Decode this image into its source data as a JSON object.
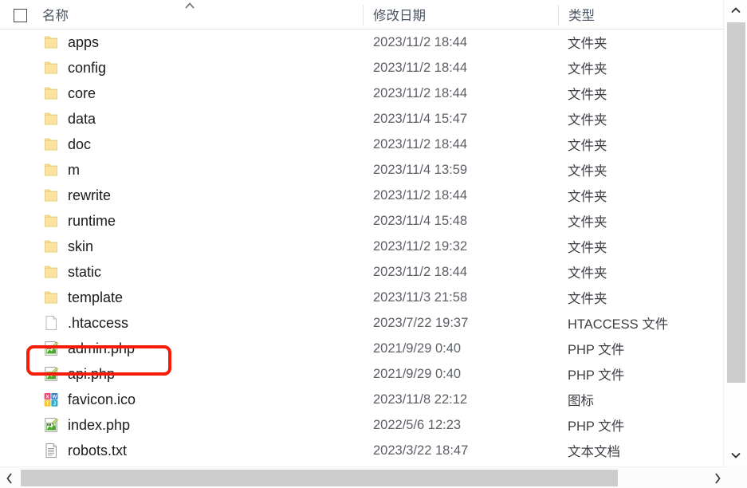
{
  "window": {
    "app": "file-explorer",
    "accent_annotation_color": "#f81b06",
    "folder_icon_color": "#fbdf9b",
    "php_icon_color": "#4aaf2a"
  },
  "columns": {
    "name": "名称",
    "date_modified": "修改日期",
    "type": "类型",
    "sort_indicator": "chevron-up-icon"
  },
  "types": {
    "folder": "文件夹",
    "htaccess": "HTACCESS 文件",
    "php": "PHP 文件",
    "icon": "图标",
    "text": "文本文档"
  },
  "rows": [
    {
      "name": "apps",
      "date": "2023/11/2 18:44",
      "type": "文件夹",
      "icon": "folder-icon"
    },
    {
      "name": "config",
      "date": "2023/11/2 18:44",
      "type": "文件夹",
      "icon": "folder-icon"
    },
    {
      "name": "core",
      "date": "2023/11/2 18:44",
      "type": "文件夹",
      "icon": "folder-icon"
    },
    {
      "name": "data",
      "date": "2023/11/4 15:47",
      "type": "文件夹",
      "icon": "folder-icon"
    },
    {
      "name": "doc",
      "date": "2023/11/2 18:44",
      "type": "文件夹",
      "icon": "folder-icon"
    },
    {
      "name": "m",
      "date": "2023/11/4 13:59",
      "type": "文件夹",
      "icon": "folder-icon"
    },
    {
      "name": "rewrite",
      "date": "2023/11/2 18:44",
      "type": "文件夹",
      "icon": "folder-icon"
    },
    {
      "name": "runtime",
      "date": "2023/11/4 15:48",
      "type": "文件夹",
      "icon": "folder-icon"
    },
    {
      "name": "skin",
      "date": "2023/11/2 19:32",
      "type": "文件夹",
      "icon": "folder-icon"
    },
    {
      "name": "static",
      "date": "2023/11/2 18:44",
      "type": "文件夹",
      "icon": "folder-icon"
    },
    {
      "name": "template",
      "date": "2023/11/3 21:58",
      "type": "文件夹",
      "icon": "folder-icon"
    },
    {
      "name": ".htaccess",
      "date": "2023/7/22 19:37",
      "type": "HTACCESS 文件",
      "icon": "blank-document-icon"
    },
    {
      "name": "admin.php",
      "date": "2021/9/29 0:40",
      "type": "PHP 文件",
      "icon": "php-file-icon"
    },
    {
      "name": "api.php",
      "date": "2021/9/29 0:40",
      "type": "PHP 文件",
      "icon": "php-file-icon"
    },
    {
      "name": "favicon.ico",
      "date": "2023/11/8 22:12",
      "type": "图标",
      "icon": "ico-file-icon"
    },
    {
      "name": "index.php",
      "date": "2022/5/6 12:23",
      "type": "PHP 文件",
      "icon": "php-file-icon"
    },
    {
      "name": "robots.txt",
      "date": "2023/3/22 18:47",
      "type": "文本文档",
      "icon": "text-document-icon"
    }
  ],
  "annotation": {
    "target_row_name": "admin.php",
    "shape": "rounded-rectangle",
    "color": "#f81b06"
  },
  "scrollbars": {
    "vertical": {
      "up_arrow": "chevron-up-icon",
      "down_arrow": "chevron-down-icon"
    },
    "horizontal": {
      "left_arrow": "chevron-left-icon",
      "right_arrow": "chevron-right-icon"
    }
  }
}
